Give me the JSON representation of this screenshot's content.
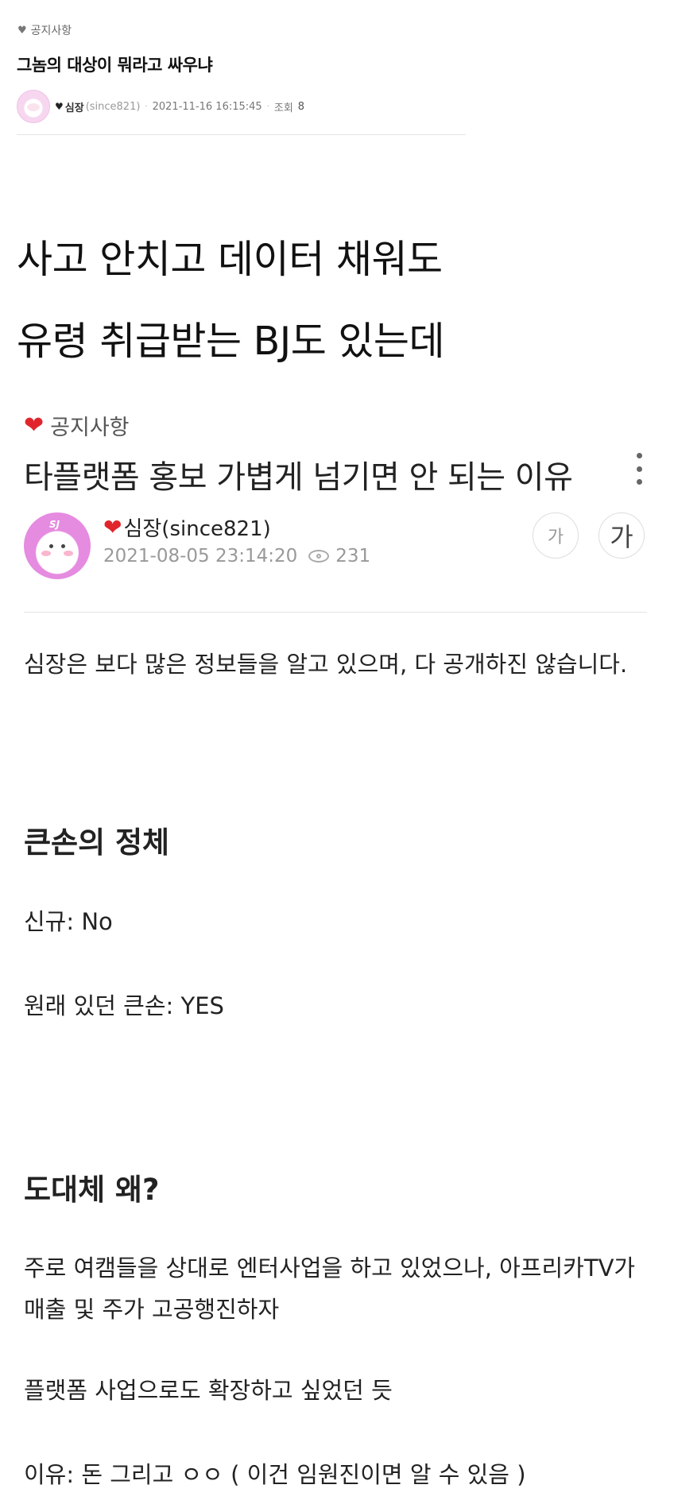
{
  "post": {
    "category": "공지사항",
    "title": "그놈의 대상이 뭐라고 싸우냐",
    "author_name": "심장",
    "author_handle": "(since821)",
    "date": "2021-11-16 16:15:45",
    "views_label": "조회",
    "views": "8",
    "dot": "·"
  },
  "body": {
    "line1": "사고 안치고 데이터 채워도",
    "line2": "유령 취급받는 BJ도 있는데"
  },
  "embed": {
    "category": "공지사항",
    "title": "타플랫폼 홍보 가볍게 넘기면 안 되는 이유",
    "author": "심장(since821)",
    "avatar_badge": "SJ",
    "date": "2021-08-05 23:14:20",
    "views": "231",
    "font_small_label": "가",
    "font_large_label": "가",
    "para1": "심장은 보다 많은 정보들을 알고 있으며,  다 공개하진 않습니다.",
    "heading1": "큰손의 정체",
    "new_line": "신규: No",
    "existing_line": "원래 있던 큰손: YES",
    "heading2": "도대체 왜?",
    "para_reason": "주로 여캠들을 상대로 엔터사업을 하고 있었으나, 아프리카TV가 매출 및 주가 고공행진하자",
    "para_expand": "플랫폼 사업으로도 확장하고 싶었던 듯",
    "para_why": "이유: 돈 그리고 ㅇㅇ ( 이건 임원진이면 알 수 있음 )"
  },
  "colors": {
    "heart_red": "#e0262c",
    "avatar_pink": "#e58be0"
  },
  "icons": [
    "heart-icon",
    "eye-icon",
    "kebab-menu-icon"
  ]
}
